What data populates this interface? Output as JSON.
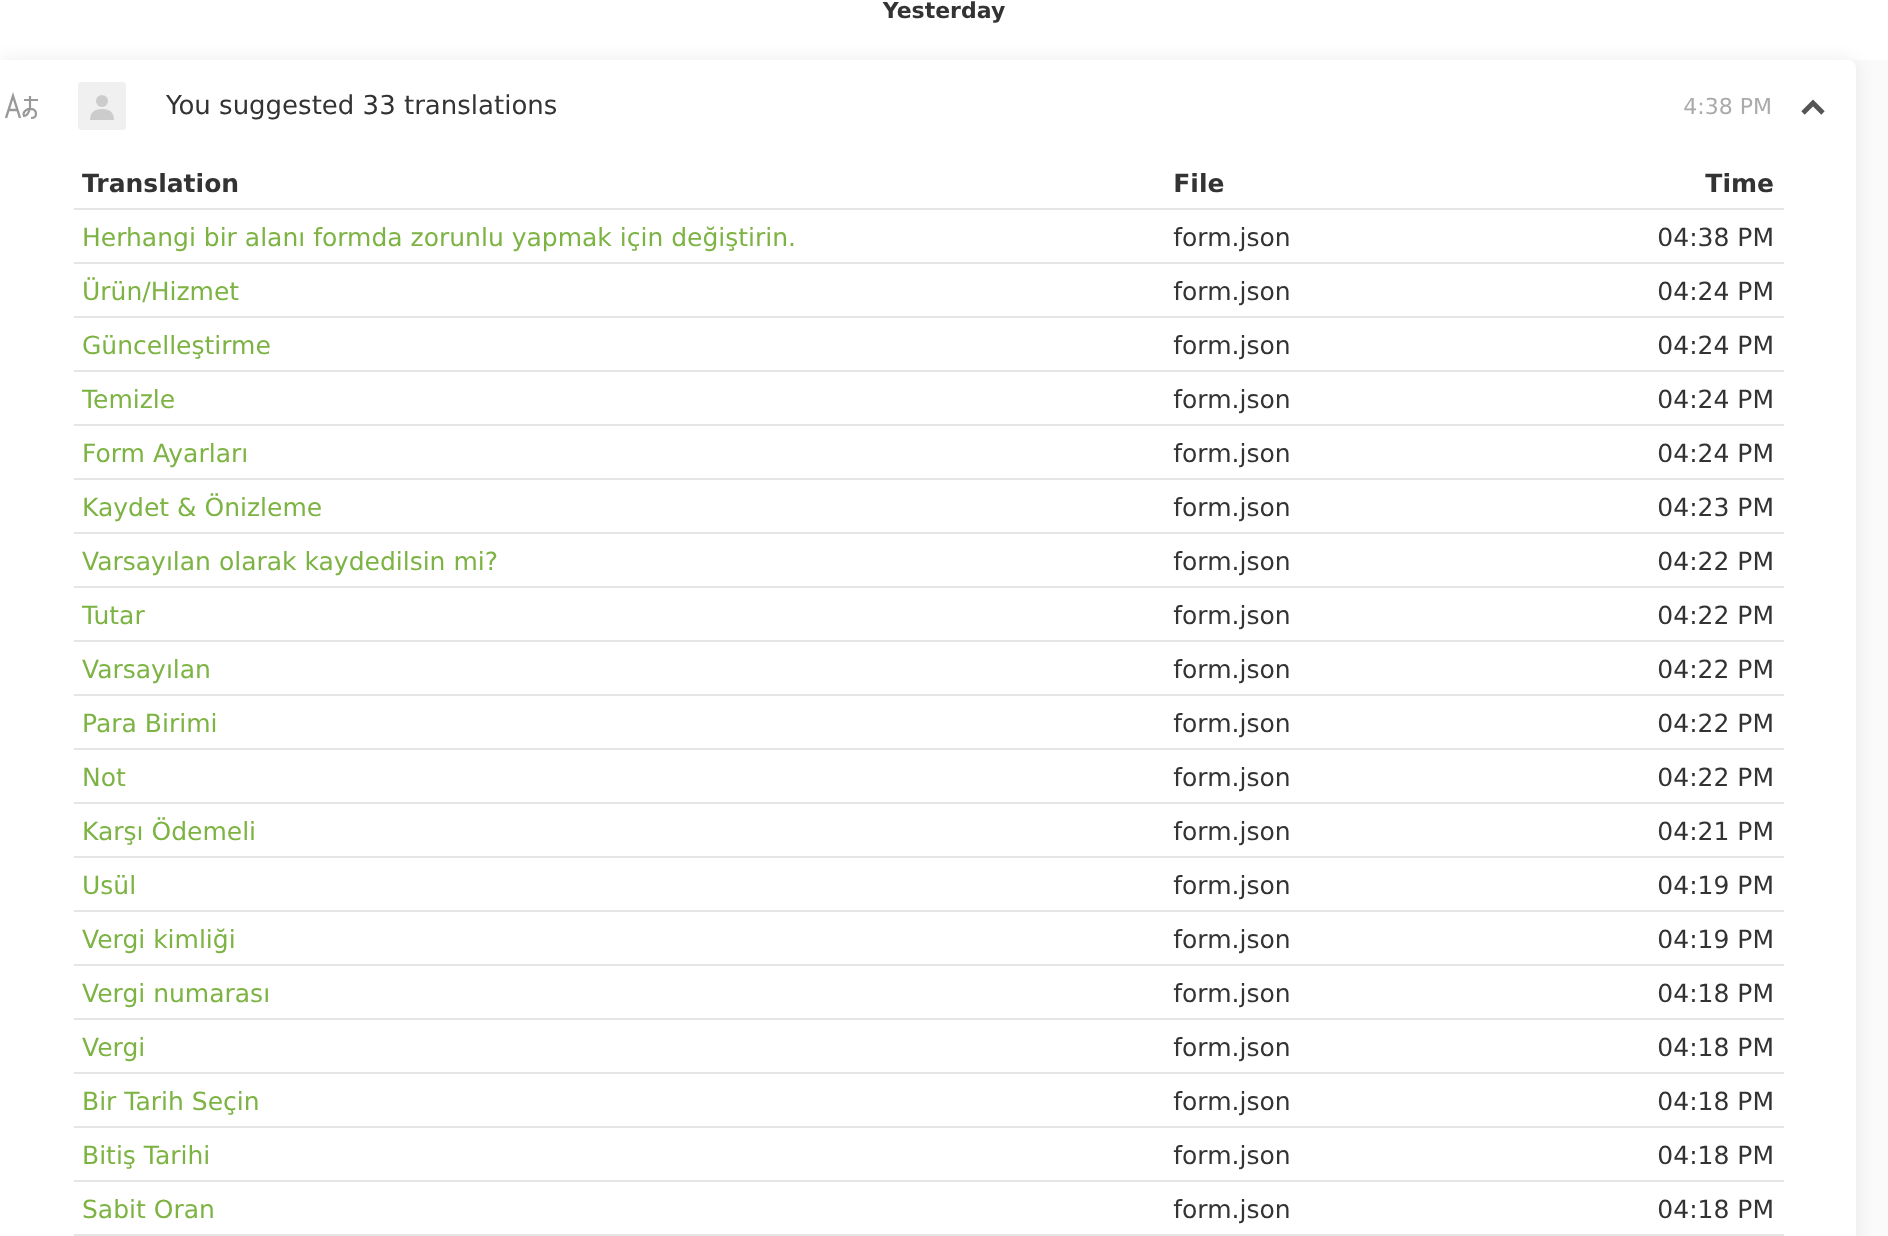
{
  "date_header": "Yesterday",
  "activity": {
    "summary": "You suggested 33 translations",
    "time": "4:38 PM",
    "expanded": true,
    "table": {
      "columns": [
        "Translation",
        "File",
        "Time"
      ],
      "rows": [
        {
          "translation": "Herhangi bir alanı formda zorunlu yapmak için değiştirin.",
          "file": "form.json",
          "time": "04:38 PM"
        },
        {
          "translation": "Ürün/Hizmet",
          "file": "form.json",
          "time": "04:24 PM"
        },
        {
          "translation": "Güncelleştirme",
          "file": "form.json",
          "time": "04:24 PM"
        },
        {
          "translation": "Temizle",
          "file": "form.json",
          "time": "04:24 PM"
        },
        {
          "translation": "Form Ayarları",
          "file": "form.json",
          "time": "04:24 PM"
        },
        {
          "translation": "Kaydet & Önizleme",
          "file": "form.json",
          "time": "04:23 PM"
        },
        {
          "translation": "Varsayılan olarak kaydedilsin mi?",
          "file": "form.json",
          "time": "04:22 PM"
        },
        {
          "translation": "Tutar",
          "file": "form.json",
          "time": "04:22 PM"
        },
        {
          "translation": "Varsayılan",
          "file": "form.json",
          "time": "04:22 PM"
        },
        {
          "translation": "Para Birimi",
          "file": "form.json",
          "time": "04:22 PM"
        },
        {
          "translation": "Not",
          "file": "form.json",
          "time": "04:22 PM"
        },
        {
          "translation": "Karşı Ödemeli",
          "file": "form.json",
          "time": "04:21 PM"
        },
        {
          "translation": "Usül",
          "file": "form.json",
          "time": "04:19 PM"
        },
        {
          "translation": "Vergi kimliği",
          "file": "form.json",
          "time": "04:19 PM"
        },
        {
          "translation": "Vergi numarası",
          "file": "form.json",
          "time": "04:18 PM"
        },
        {
          "translation": "Vergi",
          "file": "form.json",
          "time": "04:18 PM"
        },
        {
          "translation": "Bir Tarih Seçin",
          "file": "form.json",
          "time": "04:18 PM"
        },
        {
          "translation": "Bitiş Tarihi",
          "file": "form.json",
          "time": "04:18 PM"
        },
        {
          "translation": "Sabit Oran",
          "file": "form.json",
          "time": "04:18 PM"
        }
      ]
    }
  }
}
